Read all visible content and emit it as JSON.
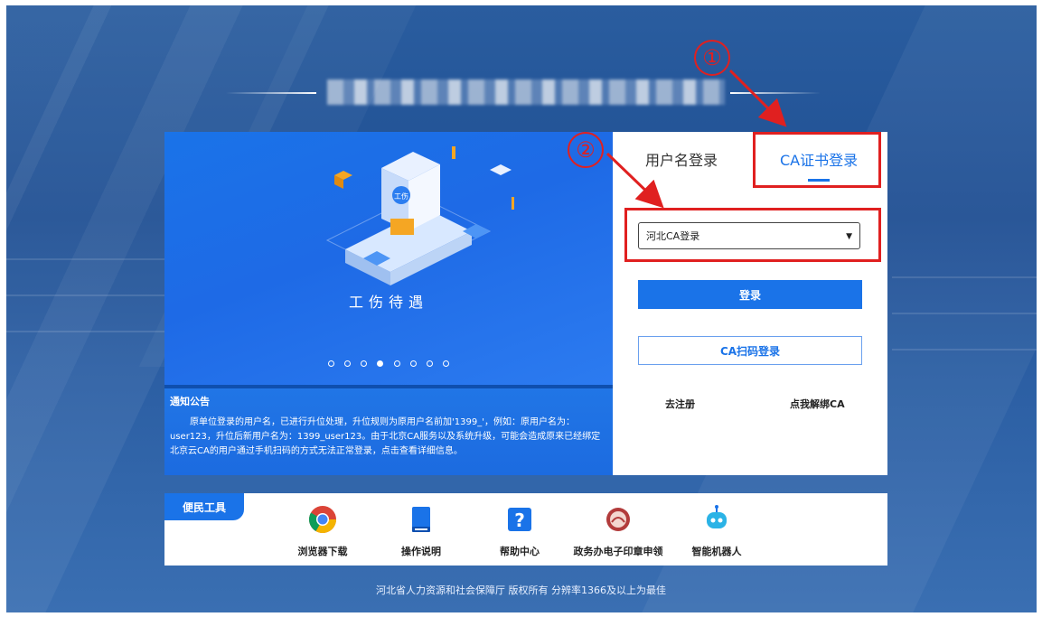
{
  "tabs": {
    "username_login": "用户名登录",
    "ca_login": "CA证书登录"
  },
  "ca_select": {
    "value": "河北CA登录"
  },
  "buttons": {
    "login": "登录",
    "ca_scan_login": "CA扫码登录"
  },
  "links": {
    "register": "去注册",
    "unbind_ca": "点我解绑CA"
  },
  "carousel": {
    "caption": "工伤待遇",
    "badge": "工伤",
    "dots": 8,
    "active_dot": 4
  },
  "notice": {
    "title": "通知公告",
    "body": "原单位登录的用户名，已进行升位处理，升位规则为原用户名前加'1399_'，例如：原用户名为：user123，升位后新用户名为：1399_user123。由于北京CA服务以及系统升级，可能会造成原来已经绑定北京云CA的用户通过手机扫码的方式无法正常登录，点击查看详细信息。"
  },
  "annotations": {
    "step1": "①",
    "step2": "②"
  },
  "tools": {
    "title": "便民工具",
    "items": [
      {
        "label": "浏览器下载",
        "icon": "chrome-icon"
      },
      {
        "label": "操作说明",
        "icon": "book-icon"
      },
      {
        "label": "帮助中心",
        "icon": "help-icon"
      },
      {
        "label": "政务办电子印章申领",
        "icon": "seal-icon"
      },
      {
        "label": "智能机器人",
        "icon": "robot-icon"
      }
    ]
  },
  "footer": {
    "text": "河北省人力资源和社会保障厅   版权所有   分辨率1366及以上为最佳"
  },
  "colors": {
    "brand": "#1a73e8",
    "annotation": "#e02020"
  }
}
